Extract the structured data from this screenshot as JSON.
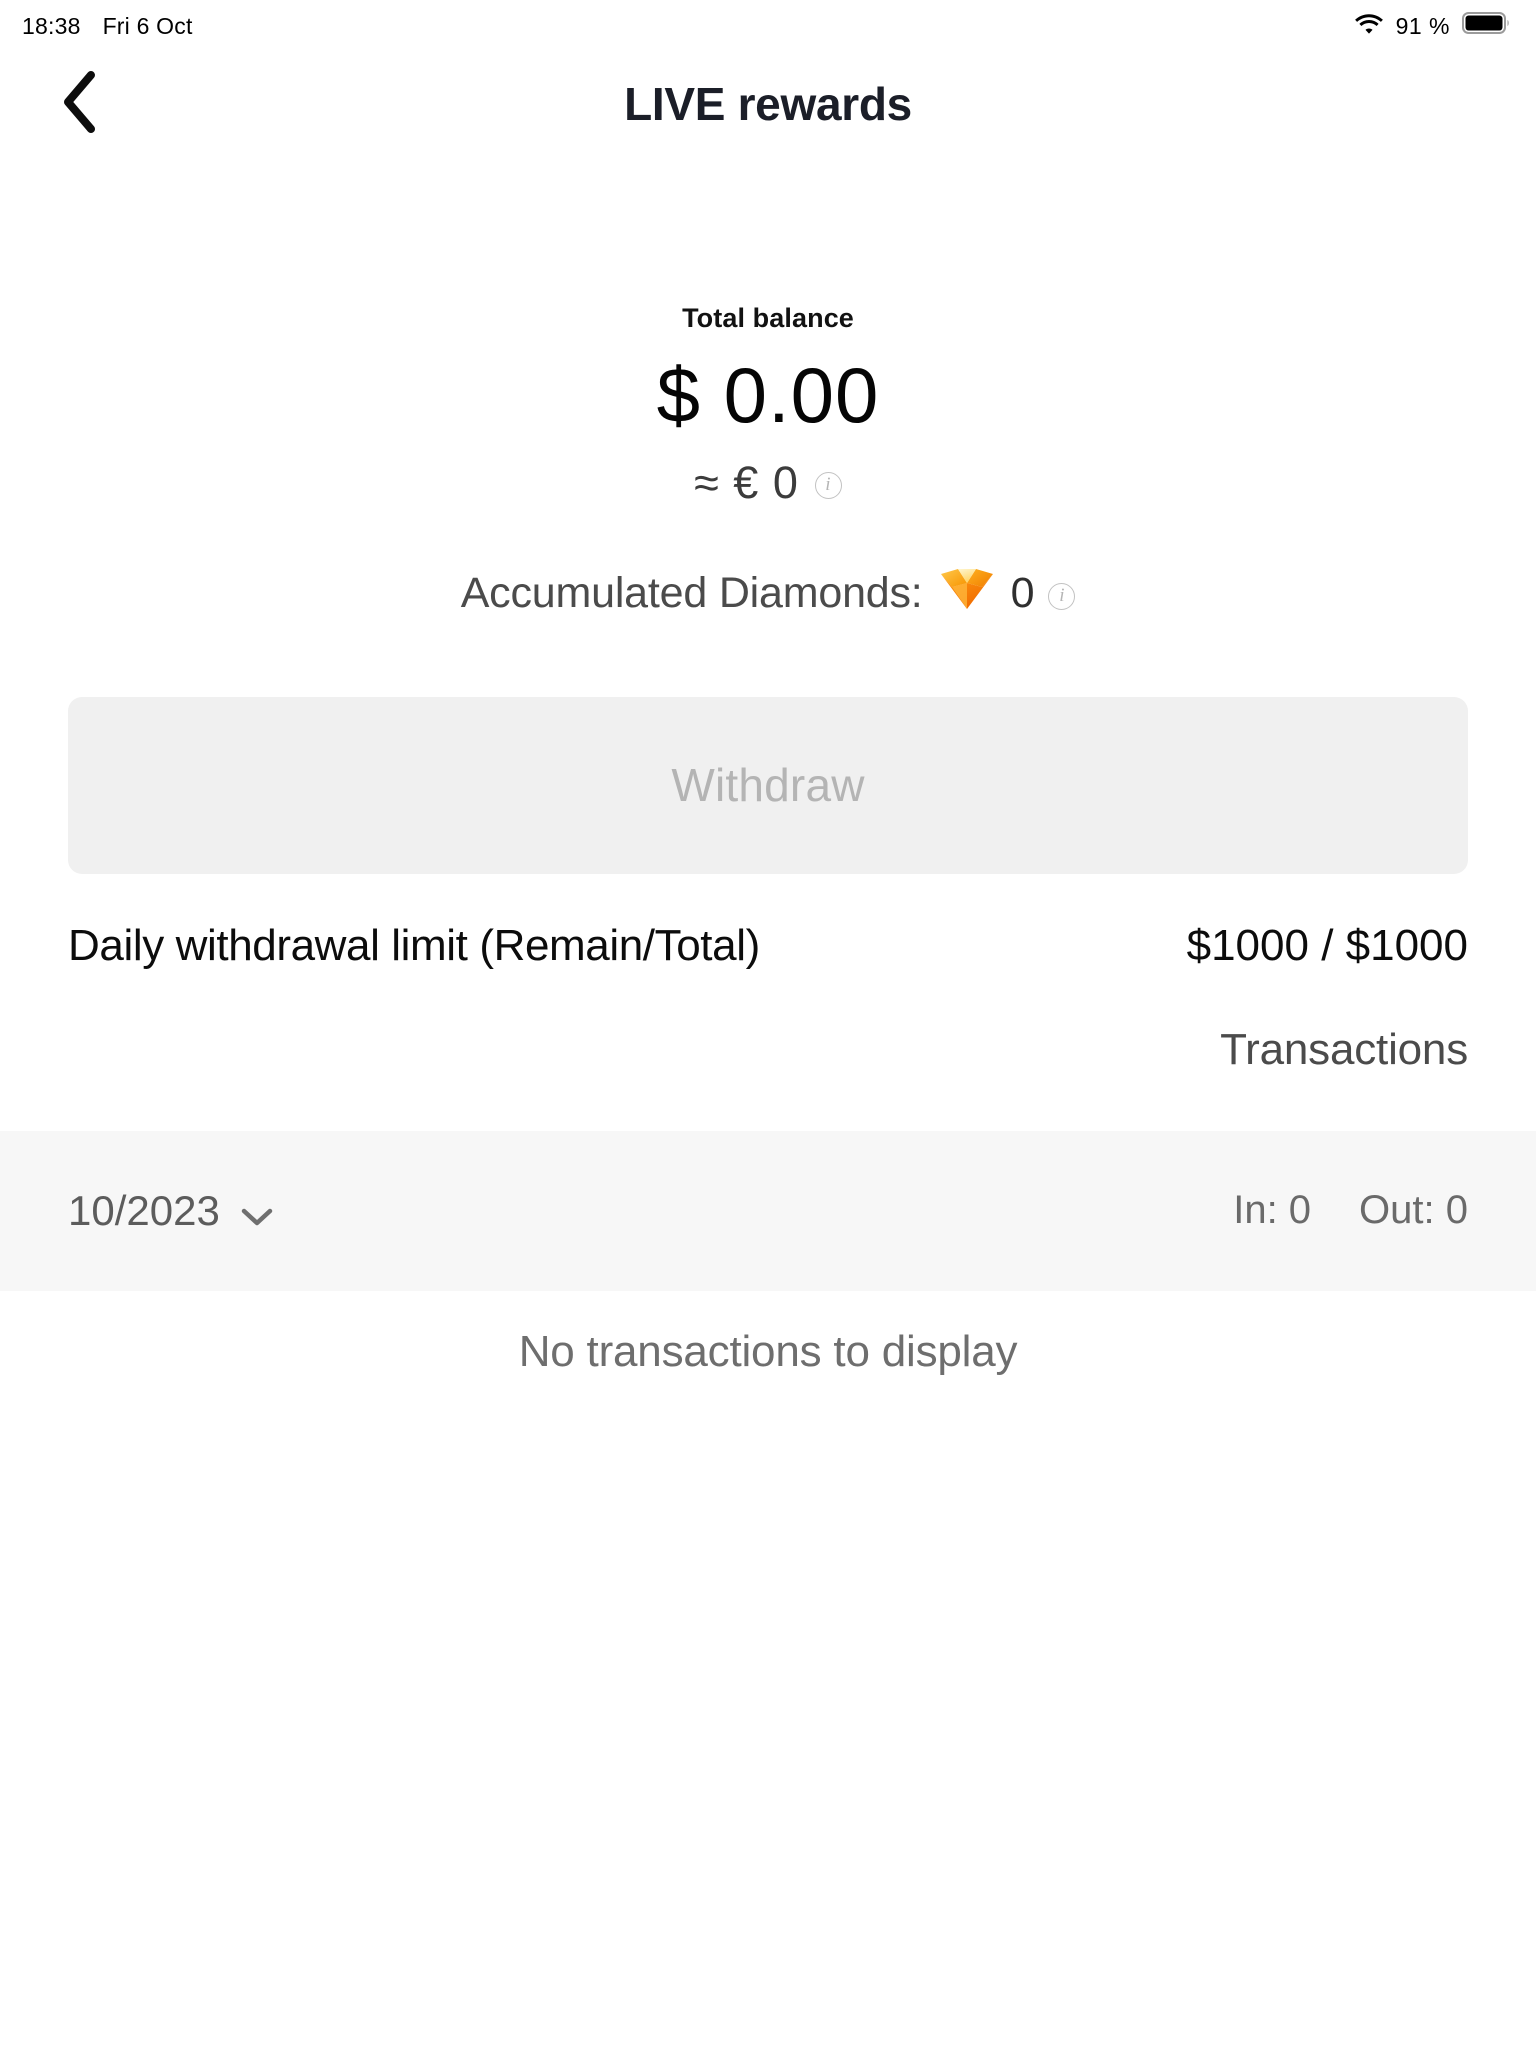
{
  "status_bar": {
    "time": "18:38",
    "date": "Fri 6 Oct",
    "battery_percent": "91 %",
    "wifi_icon": "wifi-icon",
    "battery_icon": "battery-icon"
  },
  "nav": {
    "back_icon": "chevron-left-icon",
    "title": "LIVE rewards"
  },
  "balance": {
    "label": "Total balance",
    "amount": "$ 0.00",
    "approx": "≈ € 0",
    "approx_info_icon": "info-icon",
    "diamonds_label": "Accumulated Diamonds:",
    "diamonds_icon": "diamond-icon",
    "diamonds_count": "0",
    "diamonds_info_icon": "info-icon"
  },
  "actions": {
    "withdraw_label": "Withdraw",
    "withdraw_disabled": true
  },
  "limit": {
    "label": "Daily withdrawal limit (Remain/Total)",
    "value": "$1000 / $1000"
  },
  "transactions": {
    "header": "Transactions",
    "month": "10/2023",
    "month_chevron_icon": "chevron-down-icon",
    "in_label": "In: 0",
    "out_label": "Out: 0",
    "empty_message": "No transactions to display"
  },
  "colors": {
    "accent_diamond": "#f79400",
    "title": "#1b1e28",
    "disabled_button_bg": "#f0f0f0",
    "disabled_button_text": "#b4b4b4",
    "band_bg": "#f7f7f7"
  }
}
